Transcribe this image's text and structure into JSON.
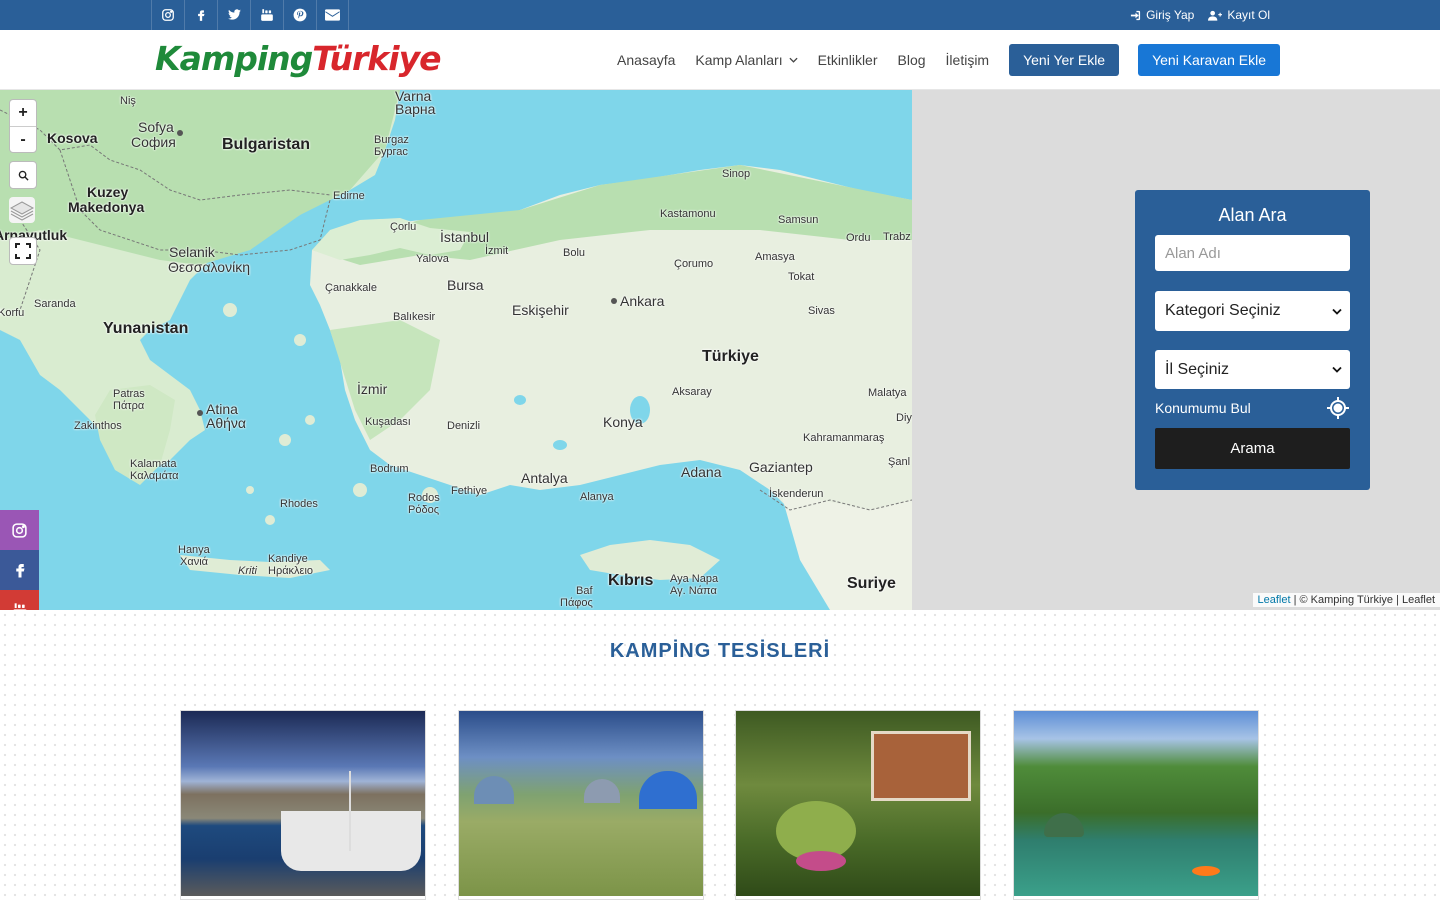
{
  "topbar": {
    "social": [
      "instagram-icon",
      "facebook-icon",
      "twitter-icon",
      "youtube-icon",
      "pinterest-icon",
      "envelope-icon"
    ],
    "login_label": "Giriş Yap",
    "register_label": "Kayıt Ol"
  },
  "header": {
    "logo_part1": "Kamping",
    "logo_part2": "Türkiye",
    "nav": {
      "home": "Anasayfa",
      "camp_areas": "Kamp Alanları",
      "events": "Etkinlikler",
      "blog": "Blog",
      "contact": "İletişim",
      "add_place": "Yeni Yer Ekle",
      "add_caravan": "Yeni Karavan Ekle"
    }
  },
  "map": {
    "controls": {
      "zoom_in": "+",
      "zoom_out": "-"
    },
    "labels": {
      "countries": [
        "Kosova",
        "Bulgaristan",
        "Kuzey",
        "Makedonya",
        "Arnavutluk",
        "Yunanistan",
        "Türkiye",
        "Kıbrıs",
        "Suriye"
      ],
      "cities": [
        "Niş",
        "Sofya",
        "София",
        "Varna",
        "Варна",
        "Burgaz",
        "Бургас",
        "Edirne",
        "Çorlu",
        "İstanbul",
        "İzmit",
        "Yalova",
        "Bolu",
        "Kastamonu",
        "Sinop",
        "Samsun",
        "Ordu",
        "Trabz",
        "Amasya",
        "Çorumo",
        "Tokat",
        "Selanik",
        "Θεσσαλονίκη",
        "Çanakkale",
        "Bursa",
        "Balıkesir",
        "Eskişehir",
        "Ankara",
        "Sivas",
        "Saranda",
        "Korfu",
        "Patras",
        "Πάτρα",
        "Atina",
        "Αθήνα",
        "Zakinthos",
        "İzmir",
        "Kuşadası",
        "Denizli",
        "Konya",
        "Aksaray",
        "Malatya",
        "Kahramanmaraş",
        "Adana",
        "Gaziantep",
        "Şanl",
        "Diy",
        "Kalamata",
        "Καλαμάτα",
        "Bodrum",
        "Antalya",
        "Alanya",
        "Fethiye",
        "Rodos",
        "Ρόδος",
        "Rhodes",
        "İskenderun",
        "Hanya",
        "Χανιά",
        "Kandiye",
        "Ηράκλειο",
        "Kriti",
        "Aya Napa",
        "Αγ. Νάπα",
        "Baf",
        "Πάφος"
      ]
    },
    "attribution_link": "Leaflet",
    "attribution_text": "| © Kamping Türkiye | Leaflet"
  },
  "search": {
    "title": "Alan Ara",
    "name_placeholder": "Alan Adı",
    "category_select": "Kategori Seçiniz",
    "city_select": "İl Seçiniz",
    "locate_label": "Konumumu Bul",
    "submit_label": "Arama"
  },
  "side_social": [
    "instagram-icon",
    "facebook-icon",
    "youtube-icon"
  ],
  "facilities": {
    "title": "KAMPİNG TESİSLERİ"
  },
  "colors": {
    "brand_blue": "#2a5f98",
    "button_blue": "#1877d6",
    "logo_green": "#1f8a3a",
    "logo_red": "#d8262c",
    "search_button": "#1e1e1e"
  }
}
